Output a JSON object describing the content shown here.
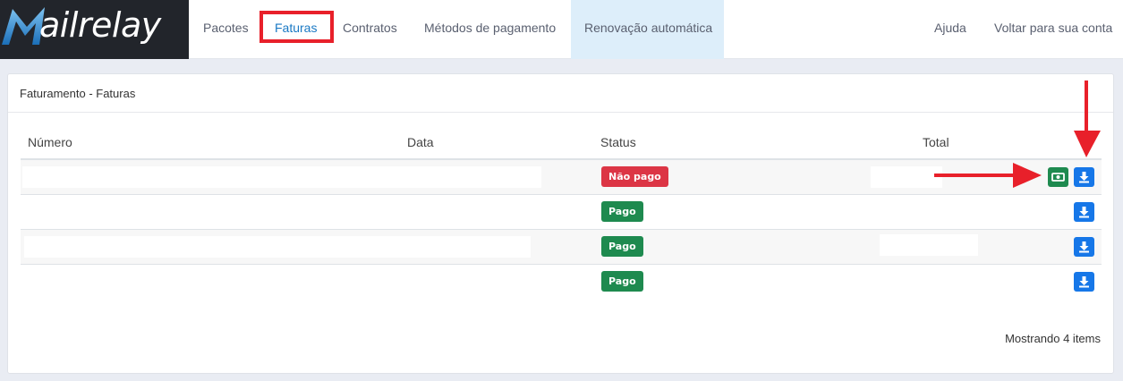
{
  "brand": {
    "logo_text": "ailrelay",
    "logo_full": "Mailrelay"
  },
  "nav": {
    "items": [
      {
        "label": "Pacotes"
      },
      {
        "label": "Faturas"
      },
      {
        "label": "Contratos"
      },
      {
        "label": "Métodos de pagamento"
      },
      {
        "label": "Renovação automática"
      }
    ],
    "right": [
      {
        "label": "Ajuda"
      },
      {
        "label": "Voltar para sua conta"
      }
    ],
    "active_color": "#1a79c4",
    "highlight_color": "#ddeefa"
  },
  "card": {
    "title": "Faturamento - Faturas"
  },
  "table": {
    "headers": [
      "Número",
      "Data",
      "Status",
      "Total"
    ],
    "rows": [
      {
        "status": "Não pago",
        "status_type": "unpaid",
        "actions": [
          "pay-money-icon",
          "download-icon"
        ]
      },
      {
        "status": "Pago",
        "status_type": "paid",
        "actions": [
          "download-icon"
        ]
      },
      {
        "status": "Pago",
        "status_type": "paid",
        "actions": [
          "download-icon"
        ]
      },
      {
        "status": "Pago",
        "status_type": "paid",
        "actions": [
          "download-icon"
        ]
      }
    ]
  },
  "footer": {
    "summary": "Mostrando 4 items"
  },
  "colors": {
    "unpaid": "#dc3545",
    "paid": "#1e8a4f",
    "download": "#1677e8",
    "annotation": "#e8202a"
  }
}
